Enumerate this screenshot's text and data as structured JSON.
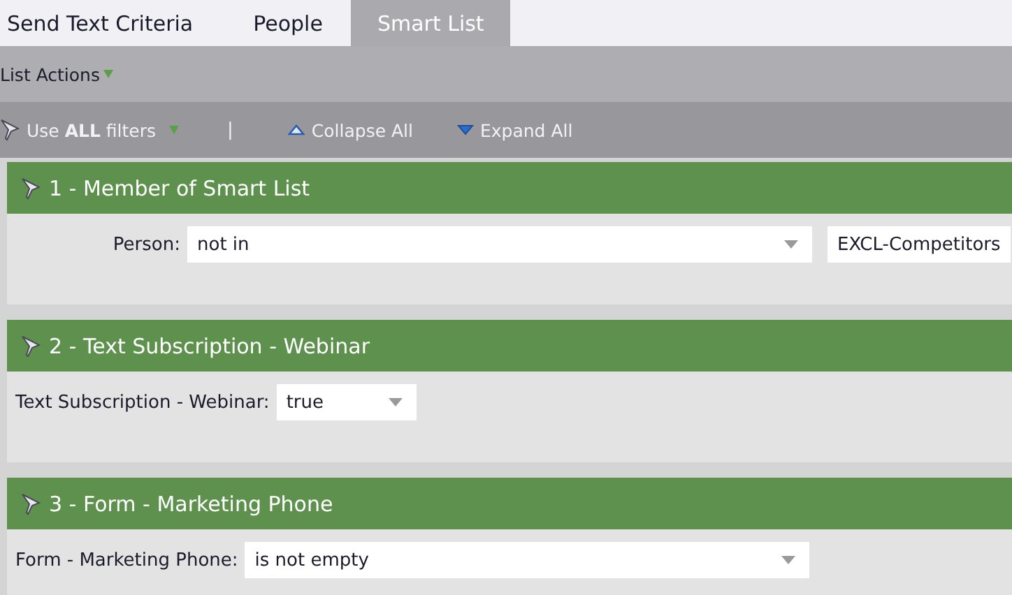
{
  "tabs": [
    {
      "label": "Send Text Criteria",
      "selected": false
    },
    {
      "label": "People",
      "selected": false
    },
    {
      "label": "Smart List",
      "selected": true
    }
  ],
  "list_actions": {
    "label": "List Actions"
  },
  "toolbar": {
    "filter_logic": "Use **ALL** filters",
    "separator": "|",
    "collapse": "Collapse All",
    "expand": "Expand All"
  },
  "filters": [
    {
      "title": "1 - Member of Smart List",
      "label": "Person:",
      "fields": [
        {
          "kind": "select",
          "value": "not in"
        },
        {
          "kind": "text",
          "value": "EXCL-Competitors"
        }
      ]
    },
    {
      "title": "2 - Text Subscription - Webinar",
      "label": "Text Subscription - Webinar:",
      "fields": [
        {
          "kind": "select",
          "value": "true"
        }
      ]
    },
    {
      "title": "3 - Form - Marketing Phone",
      "label": "Form - Marketing Phone:",
      "fields": [
        {
          "kind": "select",
          "value": "is not empty"
        }
      ]
    }
  ]
}
